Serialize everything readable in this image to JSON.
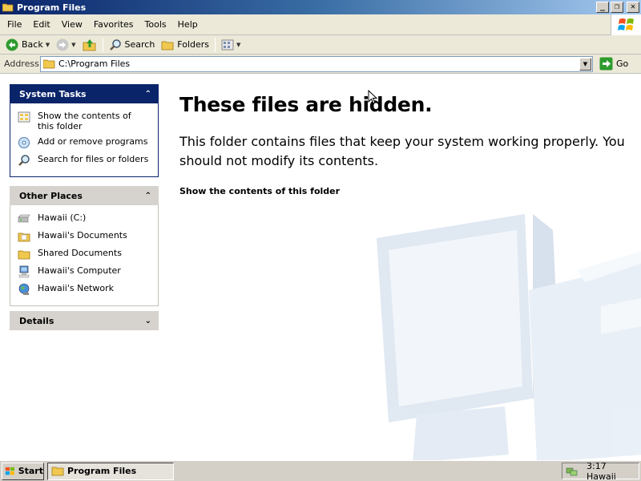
{
  "window": {
    "title": "Program Files",
    "buttons": {
      "minimize": "_",
      "restore": "❐",
      "close": "✕"
    }
  },
  "menubar": {
    "items": [
      "File",
      "Edit",
      "View",
      "Favorites",
      "Tools",
      "Help"
    ]
  },
  "toolbar": {
    "back_label": "Back",
    "search_label": "Search",
    "folders_label": "Folders"
  },
  "address": {
    "label": "Address",
    "value": "C:\\Program Files",
    "go_label": "Go"
  },
  "system_tasks": {
    "title": "System Tasks",
    "items": [
      "Show the contents of this folder",
      "Add or remove programs",
      "Search for files or folders"
    ]
  },
  "other_places": {
    "title": "Other Places",
    "items": [
      "Hawaii (C:)",
      "Hawaii's Documents",
      "Shared Documents",
      "Hawaii's Computer",
      "Hawaii's Network"
    ]
  },
  "details": {
    "title": "Details"
  },
  "main": {
    "heading": "These files are hidden.",
    "message": "This folder contains files that keep your system working properly. You should not modify its contents.",
    "show_link": "Show the contents of this folder"
  },
  "taskbar": {
    "start_label": "Start",
    "task_label": "Program Files",
    "clock": "3:17 Hawaii"
  },
  "colors": {
    "panel_header_dark": "#0a246a",
    "panel_header_light": "#d6d3ce",
    "toolbar_bg": "#ece9d8"
  }
}
